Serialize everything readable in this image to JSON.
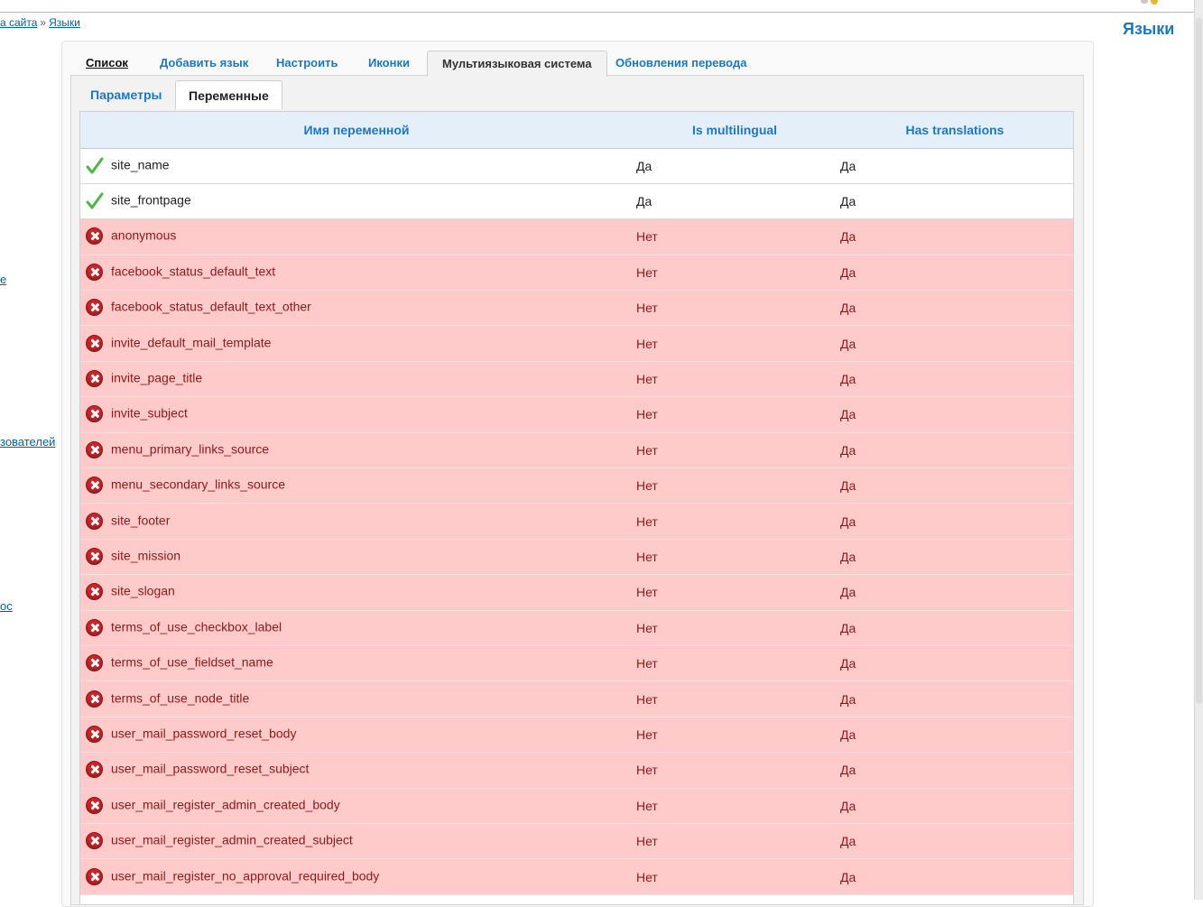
{
  "breadcrumb": {
    "items": [
      "а сайта",
      "Языки"
    ],
    "separator": "»"
  },
  "page_title": "Языки",
  "side_links": [
    "e",
    "зователей",
    "ос"
  ],
  "tabs": [
    {
      "label": "Список",
      "state": "link"
    },
    {
      "label": "Добавить язык",
      "state": "normal"
    },
    {
      "label": "Настроить",
      "state": "normal"
    },
    {
      "label": "Иконки",
      "state": "normal"
    },
    {
      "label": "Мультиязыковая система",
      "state": "active"
    },
    {
      "label": "Обновления перевода",
      "state": "normal"
    }
  ],
  "subtabs": [
    {
      "label": "Параметры",
      "state": "normal"
    },
    {
      "label": "Переменные",
      "state": "active"
    }
  ],
  "table": {
    "columns": [
      "Имя переменной",
      "Is multilingual",
      "Has translations"
    ],
    "rows": [
      {
        "status": "ok",
        "name": "site_name",
        "multilingual": "Да",
        "translations": "Да"
      },
      {
        "status": "ok",
        "name": "site_frontpage",
        "multilingual": "Да",
        "translations": "Да"
      },
      {
        "status": "error",
        "name": "anonymous",
        "multilingual": "Нет",
        "translations": "Да"
      },
      {
        "status": "error",
        "name": "facebook_status_default_text",
        "multilingual": "Нет",
        "translations": "Да"
      },
      {
        "status": "error",
        "name": "facebook_status_default_text_other",
        "multilingual": "Нет",
        "translations": "Да"
      },
      {
        "status": "error",
        "name": "invite_default_mail_template",
        "multilingual": "Нет",
        "translations": "Да"
      },
      {
        "status": "error",
        "name": "invite_page_title",
        "multilingual": "Нет",
        "translations": "Да"
      },
      {
        "status": "error",
        "name": "invite_subject",
        "multilingual": "Нет",
        "translations": "Да"
      },
      {
        "status": "error",
        "name": "menu_primary_links_source",
        "multilingual": "Нет",
        "translations": "Да"
      },
      {
        "status": "error",
        "name": "menu_secondary_links_source",
        "multilingual": "Нет",
        "translations": "Да"
      },
      {
        "status": "error",
        "name": "site_footer",
        "multilingual": "Нет",
        "translations": "Да"
      },
      {
        "status": "error",
        "name": "site_mission",
        "multilingual": "Нет",
        "translations": "Да"
      },
      {
        "status": "error",
        "name": "site_slogan",
        "multilingual": "Нет",
        "translations": "Да"
      },
      {
        "status": "error",
        "name": "terms_of_use_checkbox_label",
        "multilingual": "Нет",
        "translations": "Да"
      },
      {
        "status": "error",
        "name": "terms_of_use_fieldset_name",
        "multilingual": "Нет",
        "translations": "Да"
      },
      {
        "status": "error",
        "name": "terms_of_use_node_title",
        "multilingual": "Нет",
        "translations": "Да"
      },
      {
        "status": "error",
        "name": "user_mail_password_reset_body",
        "multilingual": "Нет",
        "translations": "Да"
      },
      {
        "status": "error",
        "name": "user_mail_password_reset_subject",
        "multilingual": "Нет",
        "translations": "Да"
      },
      {
        "status": "error",
        "name": "user_mail_register_admin_created_body",
        "multilingual": "Нет",
        "translations": "Да"
      },
      {
        "status": "error",
        "name": "user_mail_register_admin_created_subject",
        "multilingual": "Нет",
        "translations": "Да"
      },
      {
        "status": "error",
        "name": "user_mail_register_no_approval_required_body",
        "multilingual": "Нет",
        "translations": "Да"
      }
    ]
  },
  "colors": {
    "link": "#0062a0",
    "accent": "#1b78c0",
    "error_row_bg": "#ffcaca",
    "error_text": "#8b1a1a",
    "ok_icon": "#4cb648",
    "error_icon": "#c8262b",
    "header_bg": "#e5effa"
  },
  "icons": {
    "ok": "check-icon",
    "error": "error-x-icon"
  }
}
